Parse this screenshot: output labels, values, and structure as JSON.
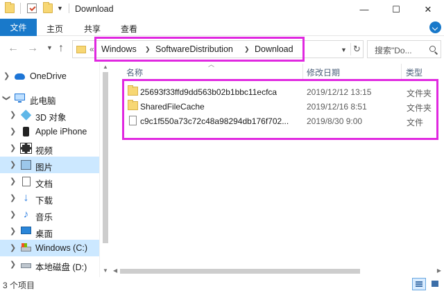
{
  "window": {
    "title": "Download",
    "controls": {
      "minimize": "—",
      "maximize": "☐",
      "close": "✕"
    }
  },
  "ribbon": {
    "tabs": [
      "文件",
      "主页",
      "共享",
      "查看"
    ]
  },
  "nav": {
    "back": "←",
    "forward": "→",
    "up": "↑",
    "breadcrumb": [
      "Windows",
      "SoftwareDistribution",
      "Download"
    ],
    "search_placeholder": "搜索\"Do..."
  },
  "sidebar": {
    "items": [
      {
        "label": "OneDrive",
        "icon": "onedrive-icon"
      },
      {
        "label": "此电脑",
        "icon": "this-pc-icon"
      },
      {
        "label": "3D 对象",
        "icon": "3d-objects-icon"
      },
      {
        "label": "Apple iPhone",
        "icon": "iphone-icon"
      },
      {
        "label": "视频",
        "icon": "video-icon"
      },
      {
        "label": "图片",
        "icon": "pictures-icon"
      },
      {
        "label": "文档",
        "icon": "documents-icon"
      },
      {
        "label": "下载",
        "icon": "downloads-icon"
      },
      {
        "label": "音乐",
        "icon": "music-icon"
      },
      {
        "label": "桌面",
        "icon": "desktop-icon"
      },
      {
        "label": "Windows (C:)",
        "icon": "drive-c-icon"
      },
      {
        "label": "本地磁盘 (D:)",
        "icon": "drive-d-icon"
      }
    ]
  },
  "files": {
    "columns": [
      "名称",
      "修改日期",
      "类型"
    ],
    "rows": [
      {
        "name": "25693f33ffd9dd563b02b1bbc11ecfca",
        "date": "2019/12/12 13:15",
        "type": "文件夹",
        "kind": "folder"
      },
      {
        "name": "SharedFileCache",
        "date": "2019/12/16 8:51",
        "type": "文件夹",
        "kind": "folder"
      },
      {
        "name": "c9c1f550a73c72c48a98294db176f702...",
        "date": "2019/8/30 9:00",
        "type": "文件",
        "kind": "file"
      }
    ]
  },
  "status": {
    "item_count": "3 个项目"
  },
  "colors": {
    "accent": "#1979ca",
    "highlight": "#e028e0",
    "selection": "#cce8ff"
  }
}
